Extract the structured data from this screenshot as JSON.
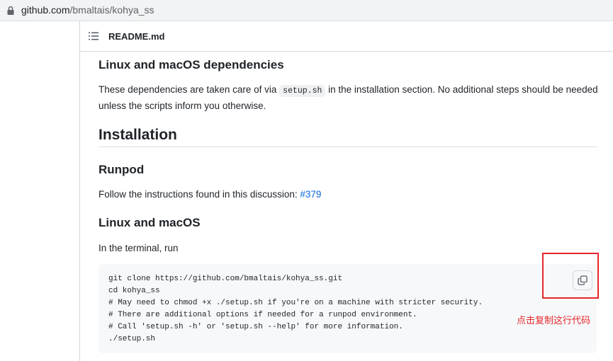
{
  "browser": {
    "url_host": "github.com",
    "url_path": "/bmaltais/kohya_ss",
    "icons": {
      "lock": "lock-icon"
    }
  },
  "readme": {
    "header_title": "README.md",
    "header_icon": "list-icon",
    "cut_text": "",
    "sections": {
      "deps_heading": "Linux and macOS dependencies",
      "deps_text_before": "These dependencies are taken care of via ",
      "deps_code": "setup.sh",
      "deps_text_after": " in the installation section. No additional steps should be needed unless the scripts inform you otherwise.",
      "install_heading": "Installation",
      "runpod_heading": "Runpod",
      "runpod_text": "Follow the instructions found in this discussion: ",
      "runpod_link": "#379",
      "linux_heading": "Linux and macOS",
      "terminal_text": "In the terminal, run"
    },
    "code_lines": [
      "git clone https://github.com/bmaltais/kohya_ss.git",
      "cd kohya_ss",
      "# May need to chmod +x ./setup.sh if you're on a machine with stricter security.",
      "# There are additional options if needed for a runpod environment.",
      "# Call 'setup.sh -h' or 'setup.sh --help' for more information.",
      "./setup.sh"
    ],
    "copy_icon": "copy-icon"
  },
  "annotation": {
    "text": "点击复制这行代码",
    "color": "#e8262a"
  },
  "colors": {
    "link": "#0969da",
    "code_bg": "#f6f8fa",
    "border": "#d0d7de"
  }
}
